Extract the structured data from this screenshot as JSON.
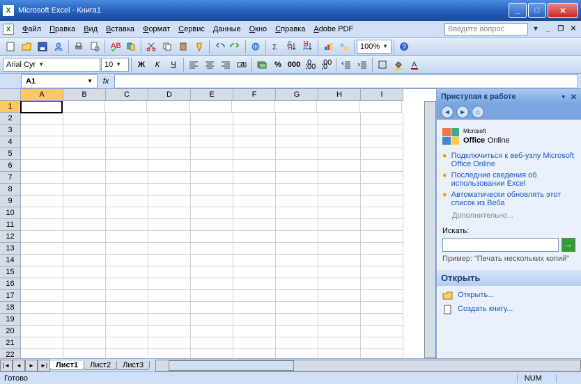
{
  "title": "Microsoft Excel - Книга1",
  "menus": [
    "Файл",
    "Правка",
    "Вид",
    "Вставка",
    "Формат",
    "Сервис",
    "Данные",
    "Окно",
    "Справка",
    "Adobe PDF"
  ],
  "ask_placeholder": "Введите вопрос",
  "font_name": "Arial Cyr",
  "font_size": "10",
  "zoom": "100%",
  "name_box": "A1",
  "columns": [
    "A",
    "B",
    "C",
    "D",
    "E",
    "F",
    "G",
    "H",
    "I"
  ],
  "rows": [
    "1",
    "2",
    "3",
    "4",
    "5",
    "6",
    "7",
    "8",
    "9",
    "10",
    "11",
    "12",
    "13",
    "14",
    "15",
    "16",
    "17",
    "18",
    "19",
    "20",
    "21",
    "22"
  ],
  "active_cell": {
    "row": 0,
    "col": 0
  },
  "sheets": [
    "Лист1",
    "Лист2",
    "Лист3"
  ],
  "active_sheet": 0,
  "taskpane": {
    "title": "Приступая к работе",
    "office_brand_small": "Microsoft",
    "office_brand": "Office",
    "office_brand_suffix": "Online",
    "links": [
      "Подключиться к веб-узлу Microsoft Office Online",
      "Последние сведения об использовании Excel",
      "Автоматически обновлять этот список из Веба"
    ],
    "more": "Дополнительно...",
    "search_label": "Искать:",
    "example_label": "Пример:",
    "example_text": "\"Печать нескольких копий\"",
    "open_section": "Открыть",
    "open_action": "Открыть...",
    "new_action": "Создать книгу..."
  },
  "status": "Готово",
  "status_right": "NUM"
}
